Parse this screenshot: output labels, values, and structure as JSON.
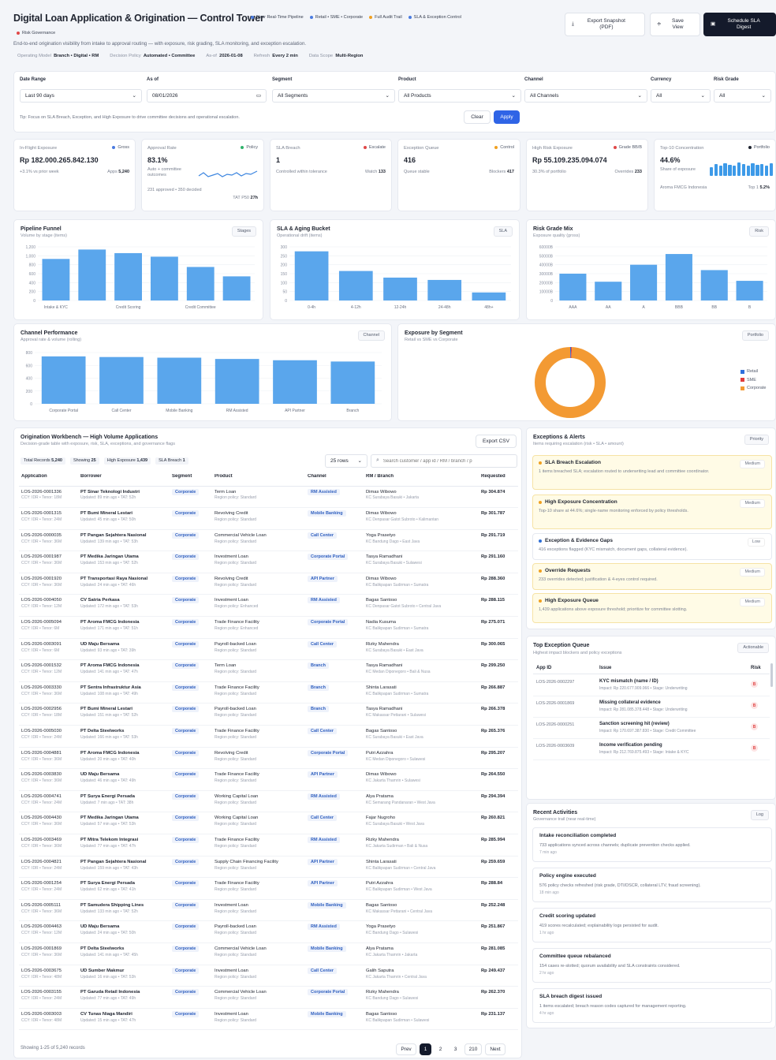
{
  "header": {
    "title": "Digital Loan Application & Origination — Control Tower",
    "pills": [
      {
        "label": "Near Real-Time Pipeline",
        "color": "#4a7be0"
      },
      {
        "label": "Retail • SME • Corporate",
        "color": "#4a7be0"
      },
      {
        "label": "Full Audit Trail",
        "color": "#f0a020"
      },
      {
        "label": "SLA & Exception Control",
        "color": "#4a7be0"
      },
      {
        "label": "Risk Governance",
        "color": "#e04848"
      }
    ],
    "subtitle": "End-to-end origination visibility from intake to approval routing — with exposure, risk grading, SLA monitoring, and exception escalation.",
    "meta": [
      {
        "k": "Operating Model",
        "v": "Branch • Digital • RM"
      },
      {
        "k": "Decision Policy",
        "v": "Automated • Committee"
      },
      {
        "k": "As-of",
        "v": "2026-01-08"
      },
      {
        "k": "Refresh",
        "v": "Every 2 min"
      },
      {
        "k": "Data Scope",
        "v": "Multi-Region"
      }
    ],
    "buttons": {
      "export": "Export Snapshot (PDF)",
      "save": "Save View",
      "schedule": "Schedule SLA Digest"
    }
  },
  "filters": {
    "date_range": {
      "label": "Date Range",
      "value": "Last 90 days"
    },
    "as_of": {
      "label": "As of",
      "value": "08/01/2026"
    },
    "segment": {
      "label": "Segment",
      "value": "All Segments"
    },
    "product": {
      "label": "Product",
      "value": "All Products"
    },
    "channel": {
      "label": "Channel",
      "value": "All Channels"
    },
    "currency": {
      "label": "Currency",
      "value": "All"
    },
    "risk_grade": {
      "label": "Risk Grade",
      "value": "All"
    },
    "tip": "Tip: Focus on SLA Breach, Exception, and High Exposure to drive committee decisions and operational escalation.",
    "clear": "Clear",
    "apply": "Apply"
  },
  "kpis": [
    {
      "label": "In-Flight Exposure",
      "tag": "Gross",
      "tag_color": "#4a7be0",
      "value": "Rp 182.000.265.842.130",
      "sub1": "+3.1% vs prior week",
      "sub2k": "Apps",
      "sub2v": "5,240"
    },
    {
      "label": "Approval Rate",
      "tag": "Policy",
      "tag_color": "#2fb36b",
      "value": "83.1%",
      "sub1": "Auto + committee outcomes",
      "sub1b": "231 approved • 350 decided",
      "sub2k": "TAT P50",
      "sub2v": "27h"
    },
    {
      "label": "SLA Breach",
      "tag": "Escalate",
      "tag_color": "#e04848",
      "value": "1",
      "sub1": "Controlled within tolerance",
      "sub2k": "Watch",
      "sub2v": "133"
    },
    {
      "label": "Exception Queue",
      "tag": "Control",
      "tag_color": "#f0a020",
      "value": "416",
      "sub1": "Queue stable",
      "sub2k": "Blockers",
      "sub2v": "417"
    },
    {
      "label": "High Risk Exposure",
      "tag": "Grade BB/B",
      "tag_color": "#e04848",
      "value": "Rp 55.109.235.094.074",
      "sub1": "30.3% of portfolio",
      "sub2k": "Overrides",
      "sub2v": "233"
    },
    {
      "label": "Top-10 Concentration",
      "tag": "Portfolio",
      "tag_color": "#1f2430",
      "value": "44.6%",
      "sub1": "Share of exposure",
      "sub1b": "Aroma FMCG Indonesia",
      "sub2k": "Top 1",
      "sub2v": "5.2%"
    }
  ],
  "kpi_bars": [
    0.6,
    0.85,
    0.75,
    0.9,
    0.8,
    0.7,
    0.95,
    0.85,
    0.75,
    0.9,
    0.8,
    0.85,
    0.7,
    0.9
  ],
  "charts": {
    "pipeline": {
      "title": "Pipeline Funnel",
      "subtitle": "Volume by stage (items)",
      "tag": "Stages",
      "color": "#5aa6ec",
      "yticks": [
        "1,200",
        "1,000",
        "800",
        "600",
        "400",
        "200",
        "0"
      ],
      "ymax": 1200,
      "values": [
        930,
        1140,
        1060,
        980,
        750,
        540
      ],
      "xlabels": [
        "Intake & KYC",
        "",
        "Credit Scoring",
        "",
        "Credit Committee",
        ""
      ]
    },
    "sla": {
      "title": "SLA & Aging Bucket",
      "subtitle": "Operational drift (items)",
      "tag": "SLA",
      "color": "#5aa6ec",
      "yticks": [
        "300",
        "250",
        "200",
        "150",
        "100",
        "50",
        "0"
      ],
      "ymax": 300,
      "values": [
        275,
        165,
        128,
        115,
        45
      ],
      "xlabels": [
        "0-4h",
        "4-12h",
        "12-24h",
        "24-48h",
        "48h+"
      ]
    },
    "risk": {
      "title": "Risk Grade Mix",
      "subtitle": "Exposure quality (gross)",
      "tag": "Risk",
      "color": "#5aa6ec",
      "yticks": [
        "60000B",
        "50000B",
        "40000B",
        "30000B",
        "20000B",
        "10000B",
        "0"
      ],
      "ymax": 60000,
      "values": [
        30000,
        21000,
        40000,
        52000,
        34000,
        22000
      ],
      "xlabels": [
        "AAA",
        "AA",
        "A",
        "BBB",
        "BB",
        "B"
      ]
    },
    "channel": {
      "title": "Channel Performance",
      "subtitle": "Approval rate & volume (rolling)",
      "tag": "Channel",
      "color": "#5aa6ec",
      "yticks": [
        "800",
        "600",
        "400",
        "200",
        "0"
      ],
      "ymax": 800,
      "values": [
        740,
        730,
        720,
        700,
        680,
        660
      ],
      "xlabels": [
        "Corporate Portal",
        "Call Center",
        "Mobile Banking",
        "RM Assisted",
        "API Partner",
        "Branch"
      ]
    },
    "exposure": {
      "title": "Exposure by Segment",
      "subtitle": "Retail vs SME vs Corporate",
      "tag": "Portfolio",
      "segments": [
        {
          "name": "Retail",
          "value": 0.4,
          "color": "#2e6fdc"
        },
        {
          "name": "SME",
          "value": 0.4,
          "color": "#e03c3c"
        },
        {
          "name": "Corporate",
          "value": 99.2,
          "color": "#f39a33"
        }
      ]
    }
  },
  "workbench": {
    "title": "Origination Workbench — High Volume Applications",
    "subtitle": "Decision-grade table with exposure, risk, SLA, exceptions, and governance flags",
    "export": "Export CSV",
    "stats": [
      {
        "k": "Total Records",
        "v": "5,240"
      },
      {
        "k": "Showing",
        "v": "25"
      },
      {
        "k": "High Exposure",
        "v": "1,439"
      },
      {
        "k": "SLA Breach",
        "v": "1"
      }
    ],
    "page_size": "25 rows",
    "search_placeholder": "Search customer / app id / RM / branch / p",
    "columns": [
      "Application",
      "Borrower",
      "Segment",
      "Product",
      "Channel",
      "RM / Branch",
      "Requested"
    ],
    "rows": [
      [
        "LOS-2026-0001336",
        "CCY: IDR • Tenor: 18M",
        "PT Sinar Teknologi Industri",
        "Updated: 89 min ago • TAT: 52h",
        "Corporate",
        "Term Loan",
        "Region policy: Standard",
        "RM Assisted",
        "Dimas Wibowo",
        "KC Surabaya Basuki • Jakarta",
        "Rp 304.874"
      ],
      [
        "LOS-2026-0001315",
        "CCY: IDR • Tenor: 24M",
        "PT Bumi Mineral Lestari",
        "Updated: 45 min ago • TAT: 50h",
        "Corporate",
        "Revolving Credit",
        "Region policy: Standard",
        "Mobile Banking",
        "Dimas Wibowo",
        "KC Denpasar Gatot Subroto • Kalimantan",
        "Rp 301.787"
      ],
      [
        "LOS-2026-0000035",
        "CCY: IDR • Tenor: 36M",
        "PT Pangan Sejahtera Nasional",
        "Updated: 139 min ago • TAT: 53h",
        "Corporate",
        "Commercial Vehicle Loan",
        "Region policy: Standard",
        "Call Center",
        "Yoga Prasetyo",
        "KC Bandung Dago • East Java",
        "Rp 291.719"
      ],
      [
        "LOS-2026-0001987",
        "CCY: IDR • Tenor: 36M",
        "PT Medika Jaringan Utama",
        "Updated: 153 min ago • TAT: 52h",
        "Corporate",
        "Investment Loan",
        "Region policy: Standard",
        "Corporate Portal",
        "Tasya Ramadhani",
        "KC Surabaya Basuki • Sulawesi",
        "Rp 291.160"
      ],
      [
        "LOS-2026-0001920",
        "CCY: IDR • Tenor: 36M",
        "PT Transportasi Raya Nasional",
        "Updated: 24 min ago • TAT: 46h",
        "Corporate",
        "Revolving Credit",
        "Region policy: Standard",
        "API Partner",
        "Dimas Wibowo",
        "KC Balikpapan Sudirman • Sumatra",
        "Rp 288.360"
      ],
      [
        "LOS-2026-0004050",
        "CCY: IDR • Tenor: 12M",
        "CV Satria Perkasa",
        "Updated: 172 min ago • TAT: 53h",
        "Corporate",
        "Investment Loan",
        "Region policy: Enhanced",
        "RM Assisted",
        "Bagas Santoso",
        "KC Denpasar Gatot Subroto • Central Java",
        "Rp 288.115"
      ],
      [
        "LOS-2026-0005094",
        "CCY: IDR • Tenor: 6M",
        "PT Aroma FMCG Indonesia",
        "Updated: 171 min ago • TAT: 51h",
        "Corporate",
        "Trade Finance Facility",
        "Region policy: Enhanced",
        "Corporate Portal",
        "Nadia Kusuma",
        "KC Balikpapan Sudirman • Sumatra",
        "Rp 275.071"
      ],
      [
        "LOS-2026-0003091",
        "CCY: IDR • Tenor: 6M",
        "UD Maju Bersama",
        "Updated: 93 min ago • TAT: 39h",
        "Corporate",
        "Payroll-backed Loan",
        "Region policy: Standard",
        "Call Center",
        "Rizky Mahendra",
        "KC Surabaya Basuki • East Java",
        "Rp 300.065"
      ],
      [
        "LOS-2026-0001532",
        "CCY: IDR • Tenor: 12M",
        "PT Aroma FMCG Indonesia",
        "Updated: 141 min ago • TAT: 47h",
        "Corporate",
        "Term Loan",
        "Region policy: Standard",
        "Branch",
        "Tasya Ramadhani",
        "KC Medan Diponegoro • Bali & Nusa",
        "Rp 299.250"
      ],
      [
        "LOS-2026-0003330",
        "CCY: IDR • Tenor: 36M",
        "PT Sentra Infrastruktur Asia",
        "Updated: 108 min ago • TAT: 49h",
        "Corporate",
        "Trade Finance Facility",
        "Region policy: Standard",
        "Branch",
        "Shinta Larasati",
        "KC Balikpapan Sudirman • Sumatra",
        "Rp 266.887"
      ],
      [
        "LOS-2026-0002956",
        "CCY: IDR • Tenor: 18M",
        "PT Bumi Mineral Lestari",
        "Updated: 151 min ago • TAT: 52h",
        "Corporate",
        "Payroll-backed Loan",
        "Region policy: Standard",
        "Branch",
        "Tasya Ramadhani",
        "KC Makassar Pettarani • Sulawesi",
        "Rp 266.378"
      ],
      [
        "LOS-2026-0005030",
        "CCY: IDR • Tenor: 24M",
        "PT Delta Steelworks",
        "Updated: 166 min ago • TAT: 53h",
        "Corporate",
        "Trade Finance Facility",
        "Region policy: Standard",
        "Call Center",
        "Bagas Santoso",
        "KC Surabaya Basuki • East Java",
        "Rp 265.376"
      ],
      [
        "LOS-2026-0004881",
        "CCY: IDR • Tenor: 36M",
        "PT Aroma FMCG Indonesia",
        "Updated: 20 min ago • TAT: 40h",
        "Corporate",
        "Revolving Credit",
        "Region policy: Standard",
        "Corporate Portal",
        "Putri Azzahra",
        "KC Medan Diponegoro • Sulawesi",
        "Rp 295.207"
      ],
      [
        "LOS-2026-0003830",
        "CCY: IDR • Tenor: 36M",
        "UD Maju Bersama",
        "Updated: 46 min ago • TAT: 49h",
        "Corporate",
        "Trade Finance Facility",
        "Region policy: Standard",
        "API Partner",
        "Dimas Wibowo",
        "KC Jakarta Thamrin • Sulawesi",
        "Rp 264.550"
      ],
      [
        "LOS-2026-0004741",
        "CCY: IDR • Tenor: 24M",
        "PT Surya Energi Persada",
        "Updated: 7 min ago • TAT: 38h",
        "Corporate",
        "Working Capital Loan",
        "Region policy: Standard",
        "RM Assisted",
        "Alya Pratama",
        "KC Semarang Pandanaran • West Java",
        "Rp 294.394"
      ],
      [
        "LOS-2026-0004430",
        "CCY: IDR • Tenor: 36M",
        "PT Medika Jaringan Utama",
        "Updated: 57 min ago • TAT: 53h",
        "Corporate",
        "Working Capital Loan",
        "Region policy: Standard",
        "Call Center",
        "Fajar Nugroho",
        "KC Surabaya Basuki • West Java",
        "Rp 260.821"
      ],
      [
        "LOS-2026-0003469",
        "CCY: IDR • Tenor: 36M",
        "PT Mitra Telekom Integrasi",
        "Updated: 77 min ago • TAT: 47h",
        "Corporate",
        "Trade Finance Facility",
        "Region policy: Standard",
        "RM Assisted",
        "Rizky Mahendra",
        "KC Jakarta Sudirman • Bali & Nusa",
        "Rp 285.994"
      ],
      [
        "LOS-2026-0004821",
        "CCY: IDR • Tenor: 24M",
        "PT Pangan Sejahtera Nasional",
        "Updated: 159 min ago • TAT: 43h",
        "Corporate",
        "Supply Chain Financing Facility",
        "Region policy: Standard",
        "API Partner",
        "Shinta Larasati",
        "KC Balikpapan Sudirman • Central Java",
        "Rp 259.659"
      ],
      [
        "LOS-2026-0001254",
        "CCY: IDR • Tenor: 24M",
        "PT Surya Energi Persada",
        "Updated: 62 min ago • TAT: 41h",
        "Corporate",
        "Trade Finance Facility",
        "Region policy: Standard",
        "API Partner",
        "Putri Azzahra",
        "KC Balikpapan Sudirman • West Java",
        "Rp 288.84"
      ],
      [
        "LOS-2026-0005111",
        "CCY: IDR • Tenor: 36M",
        "PT Samudera Shipping Lines",
        "Updated: 133 min ago • TAT: 52h",
        "Corporate",
        "Investment Loan",
        "Region policy: Standard",
        "Mobile Banking",
        "Bagas Santoso",
        "KC Makassar Pettarani • Central Java",
        "Rp 252.248"
      ],
      [
        "LOS-2026-0004463",
        "CCY: IDR • Tenor: 12M",
        "UD Maju Bersama",
        "Updated: 24 min ago • TAT: 50h",
        "Corporate",
        "Payroll-backed Loan",
        "Region policy: Standard",
        "RM Assisted",
        "Yoga Prasetyo",
        "KC Bandung Dago • Sulawesi",
        "Rp 251.867"
      ],
      [
        "LOS-2026-0001869",
        "CCY: IDR • Tenor: 36M",
        "PT Delta Steelworks",
        "Updated: 141 min ago • TAT: 45h",
        "Corporate",
        "Commercial Vehicle Loan",
        "Region policy: Standard",
        "Mobile Banking",
        "Alya Pratama",
        "KC Jakarta Thamrin • Jakarta",
        "Rp 281.085"
      ],
      [
        "LOS-2026-0003675",
        "CCY: IDR • Tenor: 48M",
        "UD Sumber Makmur",
        "Updated: 16 min ago • TAT: 53h",
        "Corporate",
        "Investment Loan",
        "Region policy: Standard",
        "Call Center",
        "Galih Saputra",
        "KC Jakarta Thamrin • Central Java",
        "Rp 249.437"
      ],
      [
        "LOS-2026-0003155",
        "CCY: IDR • Tenor: 24M",
        "PT Garuda Retail Indonesia",
        "Updated: 77 min ago • TAT: 49h",
        "Corporate",
        "Commercial Vehicle Loan",
        "Region policy: Standard",
        "Corporate Portal",
        "Rizky Mahendra",
        "KC Bandung Dago • Sulawesi",
        "Rp 262.370"
      ],
      [
        "LOS-2026-0003003",
        "CCY: IDR • Tenor: 48M",
        "CV Tunas Niaga Mandiri",
        "Updated: 15 min ago • TAT: 47h",
        "Corporate",
        "Investment Loan",
        "Region policy: Standard",
        "Mobile Banking",
        "Bagas Santoso",
        "KC Balikpapan Sudirman • Sulawesi",
        "Rp 231.137"
      ]
    ],
    "footer": "Showing 1-25 of 5,240 records",
    "pager": {
      "prev": "Prev",
      "p1": "1",
      "p2": "2",
      "p3": "3",
      "last": "210",
      "next": "Next"
    }
  },
  "exceptions": {
    "title": "Exceptions & Alerts",
    "subtitle": "Items requiring escalation (risk • SLA • amount)",
    "tag": "Priority",
    "items": [
      {
        "title": "SLA Breach Escalation",
        "desc": "1 items breached SLA; escalation routed to underwriting lead and committee coordinator.",
        "level": "Medium",
        "color": "#f0a020"
      },
      {
        "title": "High Exposure Concentration",
        "desc": "Top-10 share at 44.6%; single-name monitoring enforced by policy thresholds.",
        "level": "Medium",
        "color": "#f0a020"
      },
      {
        "title": "Exception & Evidence Gaps",
        "desc": "416 exceptions flagged (KYC mismatch, document gaps, collateral evidence).",
        "level": "Low",
        "color": "#2f6fd6"
      },
      {
        "title": "Override Requests",
        "desc": "233 overrides detected; justification & 4-eyes control required.",
        "level": "Medium",
        "color": "#f0a020"
      },
      {
        "title": "High Exposure Queue",
        "desc": "1,439 applications above exposure threshold; prioritize for committee slotting.",
        "level": "Medium",
        "color": "#f0a020"
      }
    ]
  },
  "top_queue": {
    "title": "Top Exception Queue",
    "subtitle": "Highest impact blockers and policy exceptions",
    "tag": "Actionable",
    "columns": [
      "App ID",
      "Issue",
      "Risk"
    ],
    "rows": [
      {
        "id": "LOS-2026-0002297",
        "issue": "KYC mismatch (name / ID)",
        "impact": "Impact: Rp 220.677.909.066 • Stage: Underwriting",
        "risk": "B"
      },
      {
        "id": "LOS-2026-0001869",
        "issue": "Missing collateral evidence",
        "impact": "Impact: Rp 281.085.378.448 • Stage: Underwriting",
        "risk": "B"
      },
      {
        "id": "LOS-2026-0000251",
        "issue": "Sanction screening hit (review)",
        "impact": "Impact: Rp 170.697.387.830 • Stage: Credit Committee",
        "risk": "B"
      },
      {
        "id": "LOS-2026-0003609",
        "issue": "Income verification pending",
        "impact": "Impact: Rp 212.769.875.493 • Stage: Intake & KYC",
        "risk": "B"
      }
    ]
  },
  "activities": {
    "title": "Recent Activities",
    "subtitle": "Governance trail (near real-time)",
    "tag": "Log",
    "items": [
      {
        "title": "Intake reconciliation completed",
        "desc": "733 applications synced across channels; duplicate prevention checks applied.",
        "when": "7 min ago"
      },
      {
        "title": "Policy engine executed",
        "desc": "576 policy checks refreshed (risk grade, DTI/DSCR, collateral LTV, fraud screening).",
        "when": "18 min ago"
      },
      {
        "title": "Credit scoring updated",
        "desc": "419 scores recalculated; explainability logs persisted for audit.",
        "when": "1 hr ago"
      },
      {
        "title": "Committee queue rebalanced",
        "desc": "154 cases re-slotted; quorum availability and SLA constraints considered.",
        "when": "2 hr ago"
      },
      {
        "title": "SLA breach digest issued",
        "desc": "1 items escalated; breach reason codes captured for management reporting.",
        "when": "4 hr ago"
      }
    ]
  }
}
